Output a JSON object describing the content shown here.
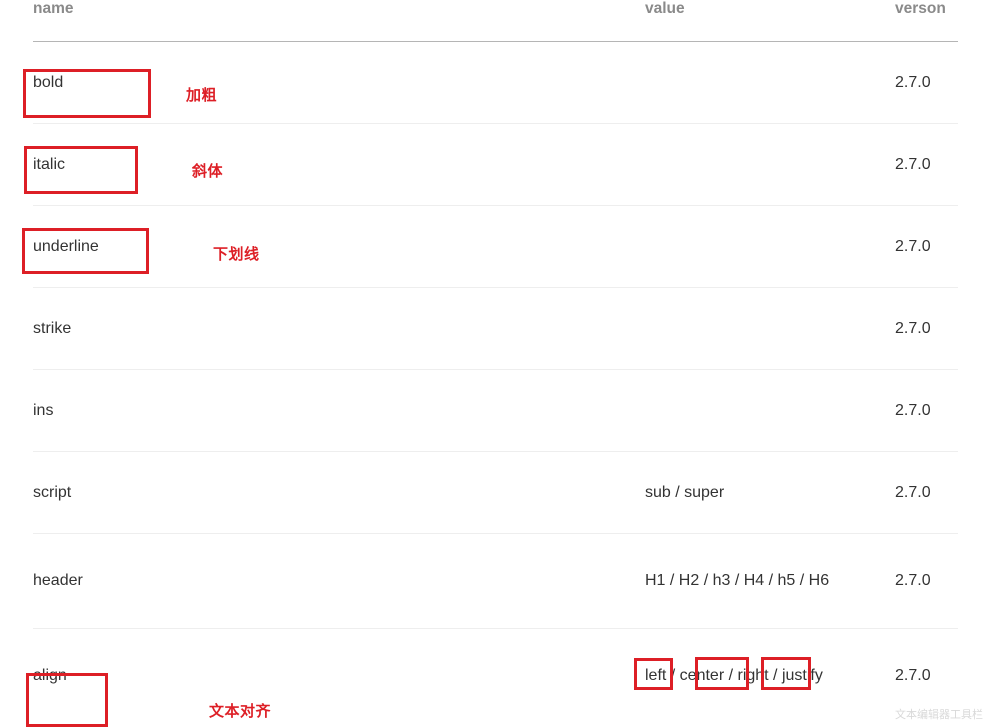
{
  "table": {
    "columns": [
      {
        "key": "name",
        "label": "name"
      },
      {
        "key": "value",
        "label": "value"
      },
      {
        "key": "version",
        "label": "verson"
      }
    ],
    "rows": [
      {
        "name": "bold",
        "value": "",
        "version": "2.7.0"
      },
      {
        "name": "italic",
        "value": "",
        "version": "2.7.0"
      },
      {
        "name": "underline",
        "value": "",
        "version": "2.7.0"
      },
      {
        "name": "strike",
        "value": "",
        "version": "2.7.0"
      },
      {
        "name": "ins",
        "value": "",
        "version": "2.7.0"
      },
      {
        "name": "script",
        "value": "sub / super",
        "version": "2.7.0"
      },
      {
        "name": "header",
        "value": "H1 / H2 / h3 / H4 / h5 / H6",
        "version": "2.7.0"
      },
      {
        "name": "align",
        "value": "left / center / right / justify",
        "version": "2.7.0"
      }
    ]
  },
  "annotations": {
    "accent_color": "#dd1f26",
    "labels": [
      {
        "id": "bold",
        "text": "加粗"
      },
      {
        "id": "italic",
        "text": "斜体"
      },
      {
        "id": "underline",
        "text": "下划线"
      },
      {
        "id": "align",
        "text": "文本对齐"
      }
    ]
  },
  "watermark": {
    "text": "文本编辑器工具栏"
  },
  "colors": {
    "header_text": "#8a8a8a",
    "body_text": "#333333",
    "header_rule": "#b5b5b5",
    "row_rule": "#eeeeee",
    "annotation_red": "#dd1f26"
  }
}
